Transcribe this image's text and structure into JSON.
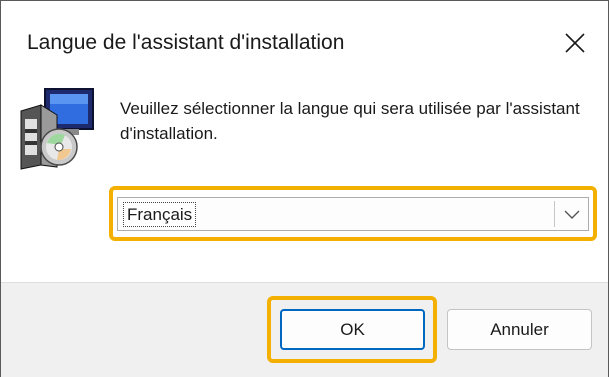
{
  "window": {
    "title": "Langue de l'assistant d'installation"
  },
  "message": "Veuillez sélectionner la langue qui sera utilisée par l'assistant d'installation.",
  "language_select": {
    "selected": "Français"
  },
  "buttons": {
    "ok": "OK",
    "cancel": "Annuler"
  },
  "colors": {
    "highlight": "#f4b000",
    "default_button_border": "#0067c0",
    "footer_background": "#f0f0f0"
  },
  "icons": [
    "setup-installer-icon",
    "close-icon",
    "chevron-down-icon"
  ]
}
